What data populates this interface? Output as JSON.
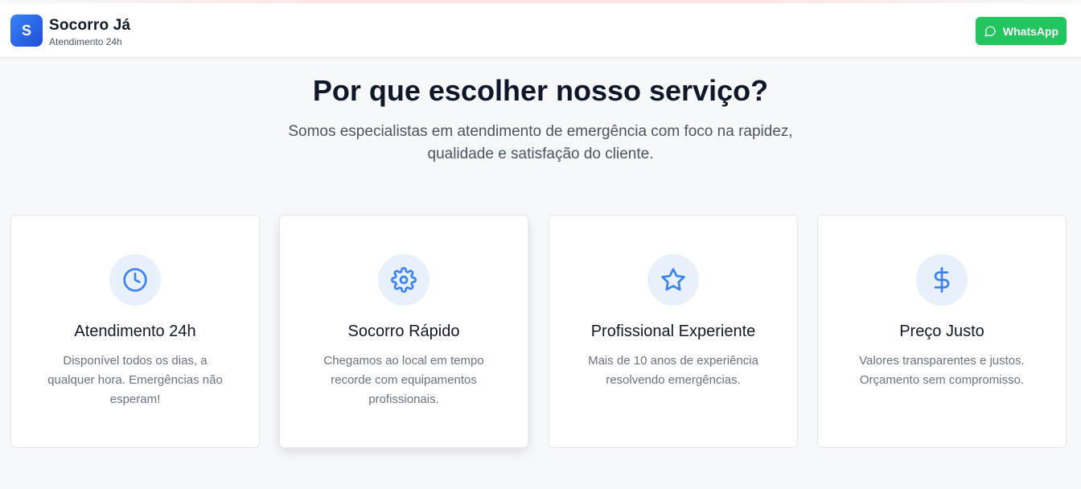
{
  "header": {
    "logo_letter": "S",
    "brand_name": "Socorro Já",
    "brand_sub": "Atendimento 24h",
    "whatsapp_label": "WhatsApp"
  },
  "section": {
    "title": "Por que escolher nosso serviço?",
    "subtitle": "Somos especialistas em atendimento de emergência com foco na rapidez, qualidade e satisfação do cliente."
  },
  "cards": [
    {
      "icon": "clock-icon",
      "title": "Atendimento 24h",
      "desc": "Disponível todos os dias, a qualquer hora. Emergências não esperam!"
    },
    {
      "icon": "gear-icon",
      "title": "Socorro Rápido",
      "desc": "Chegamos ao local em tempo recorde com equipamentos profissionais."
    },
    {
      "icon": "star-icon",
      "title": "Profissional Experiente",
      "desc": "Mais de 10 anos de experiência resolvendo emergências."
    },
    {
      "icon": "dollar-icon",
      "title": "Preço Justo",
      "desc": "Valores transparentes e justos. Orçamento sem compromisso."
    }
  ],
  "colors": {
    "accent": "#3b82f6",
    "whatsapp": "#22c55e",
    "icon_bg": "#e8f0fc"
  }
}
